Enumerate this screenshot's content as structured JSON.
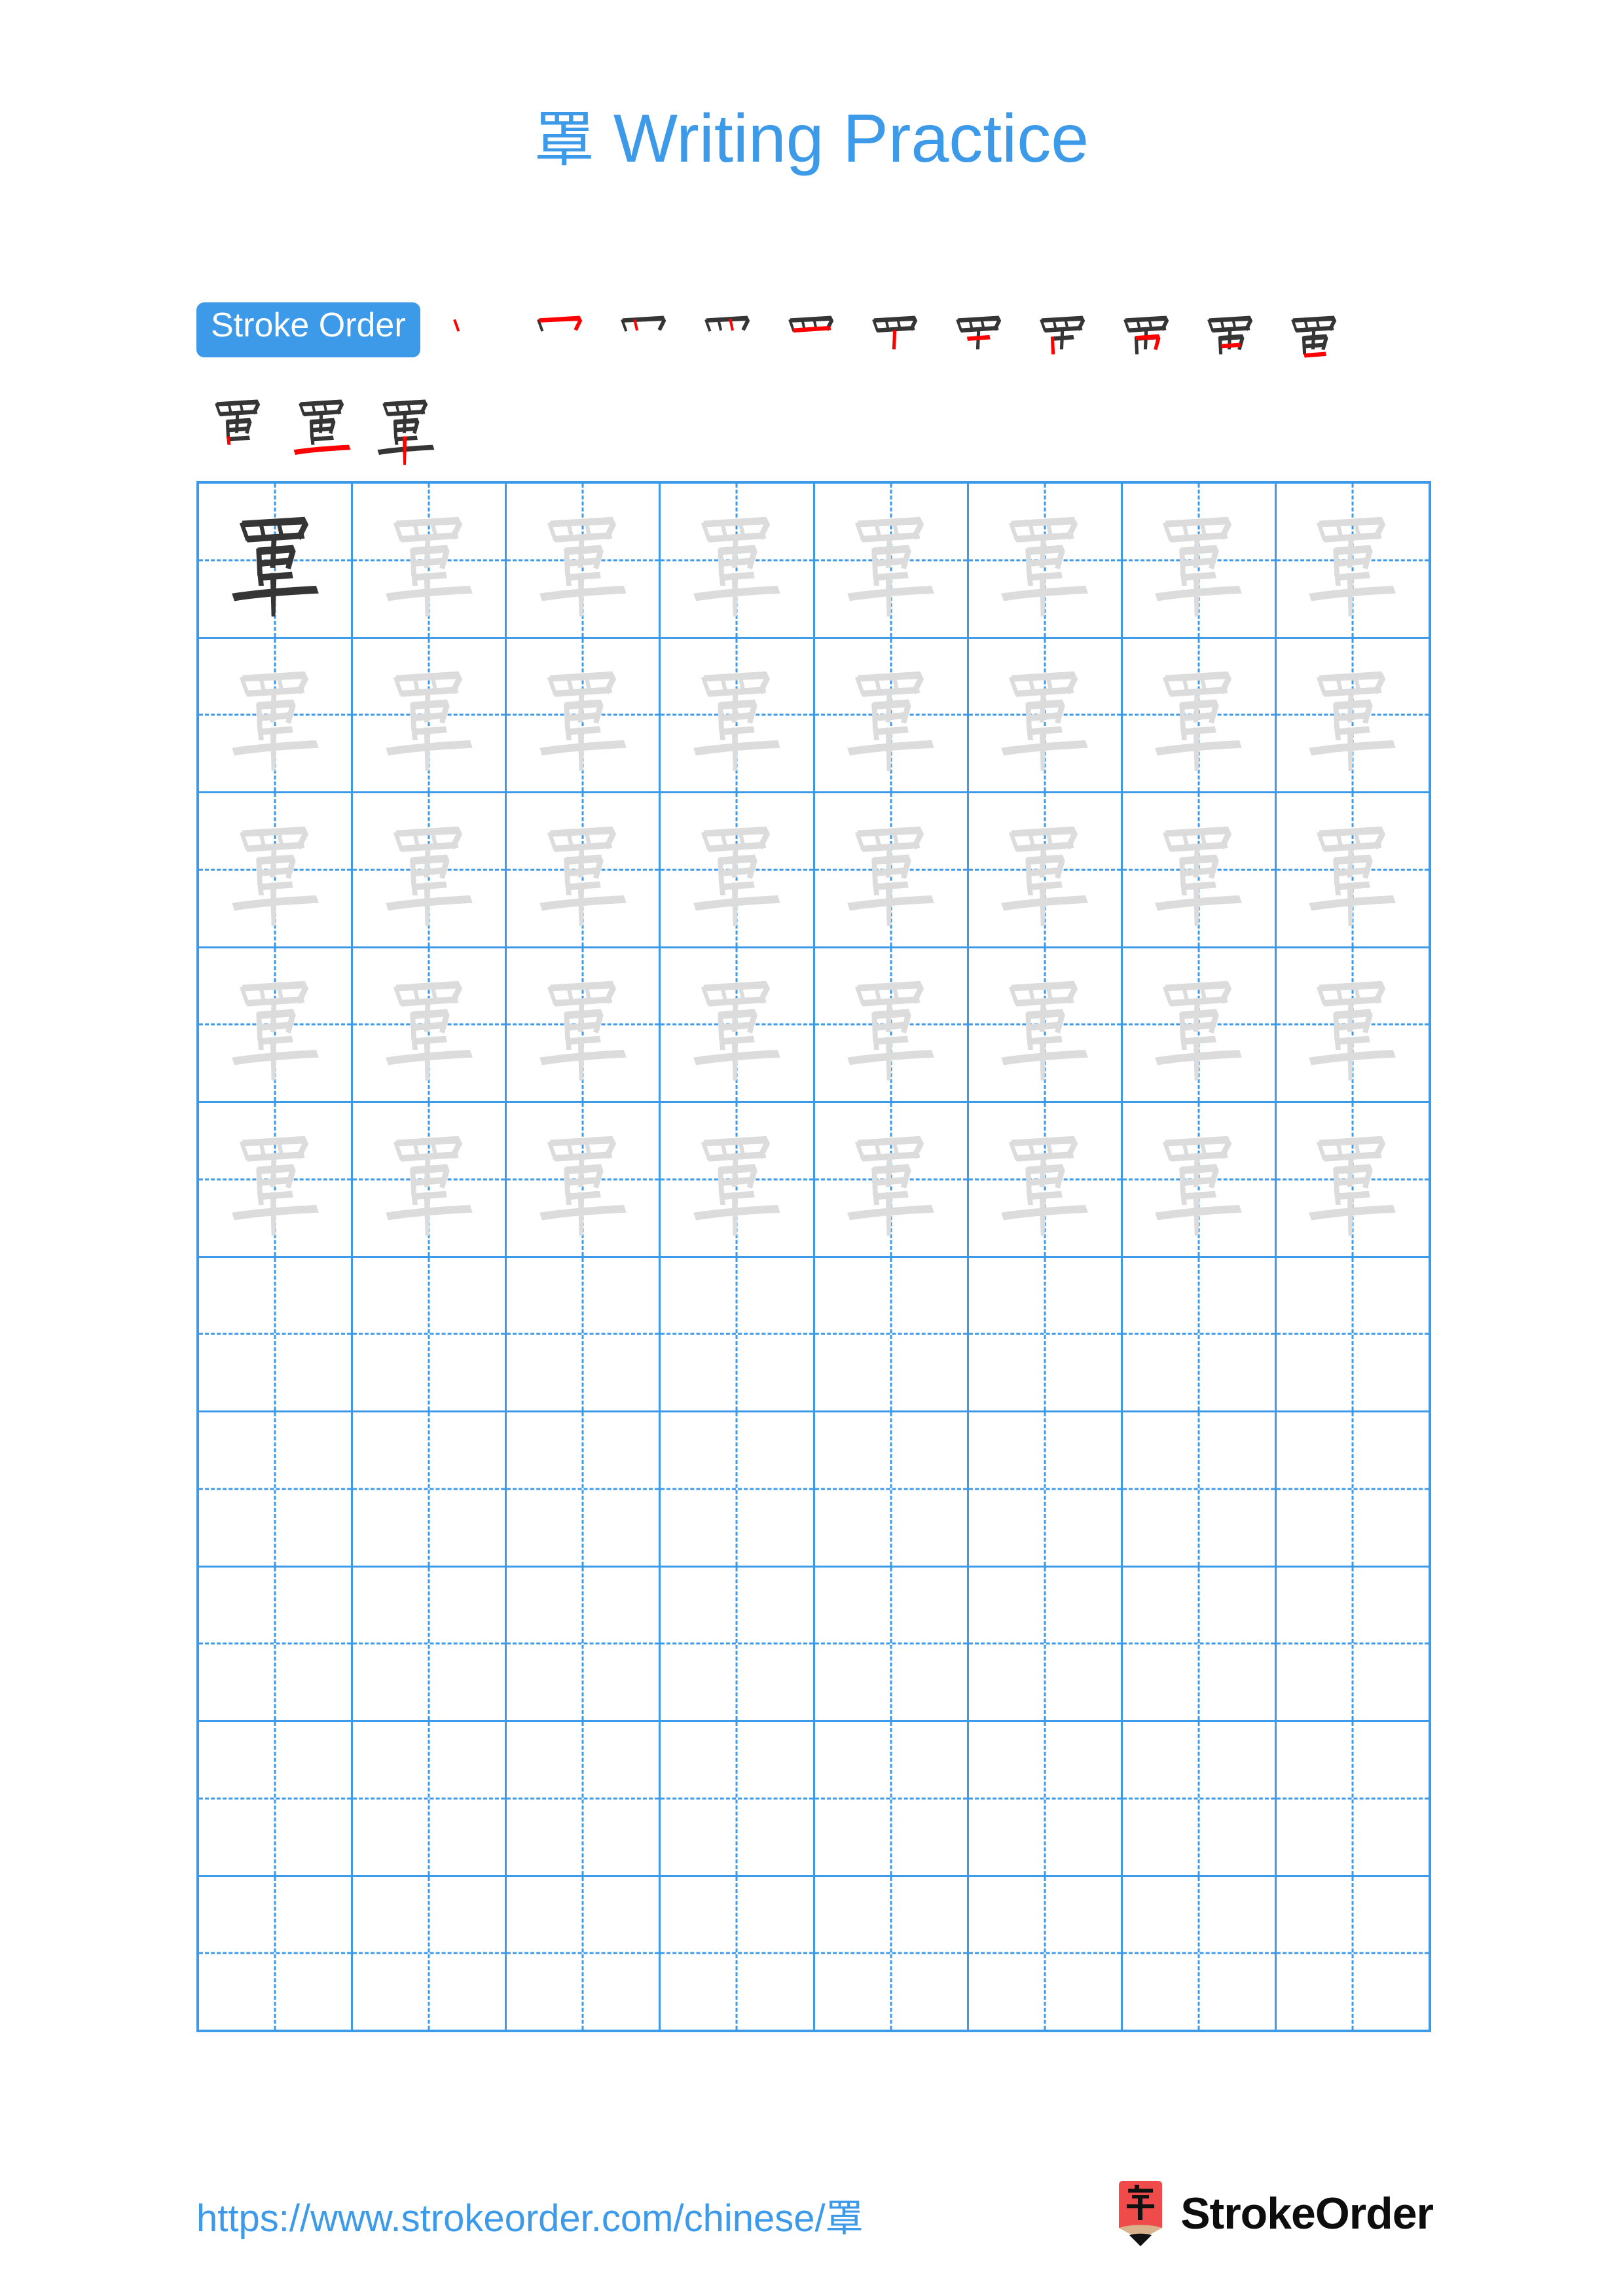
{
  "page": {
    "character": "罩",
    "title_suffix": "Writing Practice",
    "background_color": "#ffffff",
    "accent_color": "#3d9ae8",
    "grid_line_color": "#3d9ae8",
    "trace_ink_color": "#dcdcdc",
    "model_ink_color": "#353535",
    "new_stroke_color": "#ff0000",
    "logo_red": "#f04b4b",
    "logo_wood": "#d9b38c"
  },
  "stroke_order": {
    "badge_label": "Stroke Order",
    "total_strokes": 14,
    "steps": [
      {
        "index": 1,
        "cumulative_strokes": 1
      },
      {
        "index": 2,
        "cumulative_strokes": 2
      },
      {
        "index": 3,
        "cumulative_strokes": 3
      },
      {
        "index": 4,
        "cumulative_strokes": 4
      },
      {
        "index": 5,
        "cumulative_strokes": 5
      },
      {
        "index": 6,
        "cumulative_strokes": 6
      },
      {
        "index": 7,
        "cumulative_strokes": 7
      },
      {
        "index": 8,
        "cumulative_strokes": 8
      },
      {
        "index": 9,
        "cumulative_strokes": 9
      },
      {
        "index": 10,
        "cumulative_strokes": 10
      },
      {
        "index": 11,
        "cumulative_strokes": 11
      },
      {
        "index": 12,
        "cumulative_strokes": 12
      },
      {
        "index": 13,
        "cumulative_strokes": 13
      },
      {
        "index": 14,
        "cumulative_strokes": 14
      }
    ]
  },
  "practice_grid": {
    "columns": 8,
    "rows": 10,
    "filled_rows": 5,
    "empty_rows": 5,
    "model_cell": {
      "row": 1,
      "column": 1
    }
  },
  "footer": {
    "url": "https://www.strokeorder.com/chinese/罩",
    "brand_name": "StrokeOrder",
    "brand_mark_char": "字"
  }
}
